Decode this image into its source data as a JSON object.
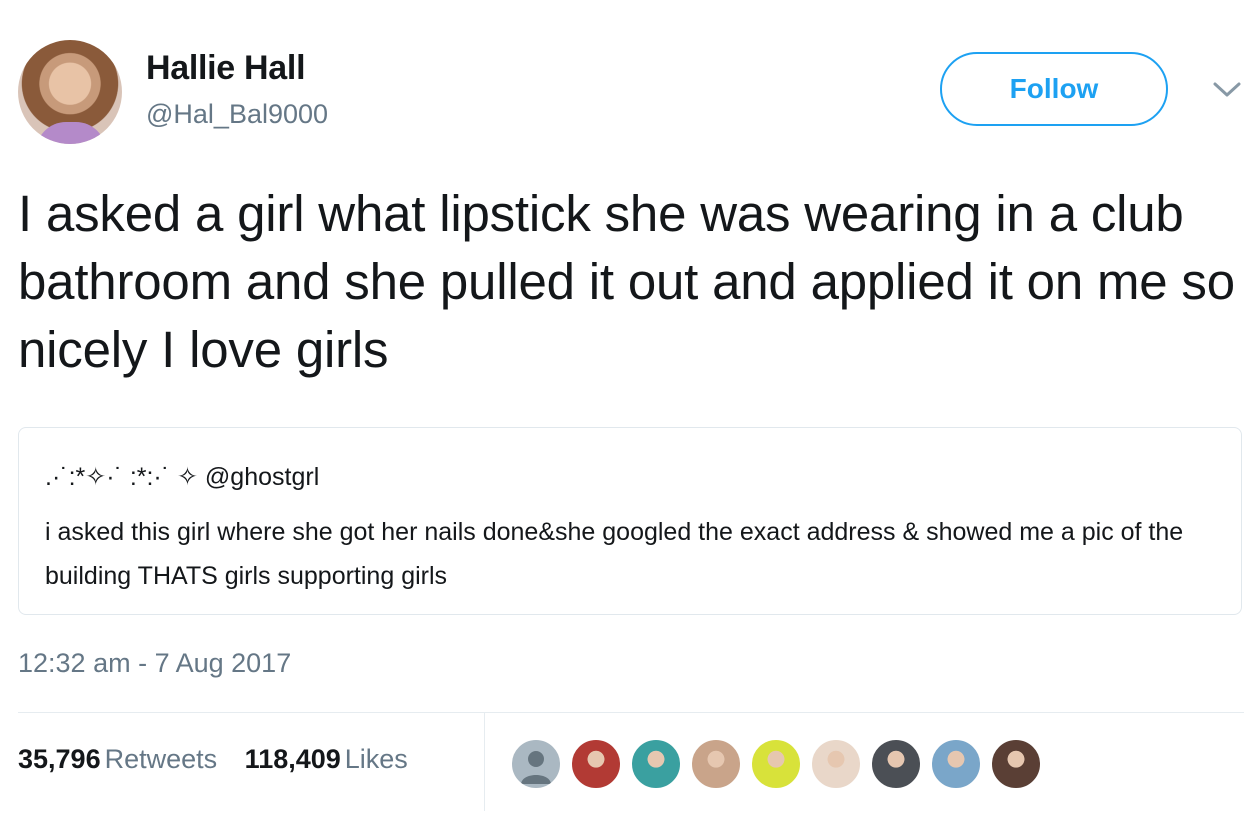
{
  "user": {
    "display_name": "Hallie Hall",
    "handle": "@Hal_Bal9000"
  },
  "actions": {
    "follow_label": "Follow",
    "more_icon": "chevron-down-icon"
  },
  "tweet": {
    "text": "I asked a girl what lipstick she was wearing in a club bathroom and she pulled it out and applied it on me so nicely I love girls",
    "timestamp": "12:32 am - 7 Aug 2017"
  },
  "quoted_tweet": {
    "name": ".·˙:*✧·˙ :*:·˙ ✧ @ghostgrl",
    "text": "i asked this girl where she got her nails done&she googled the exact address & showed me a pic of the building THATS girls supporting girls"
  },
  "stats": {
    "retweets_count": "35,796",
    "retweets_label": "Retweets",
    "likes_count": "118,409",
    "likes_label": "Likes"
  },
  "colors": {
    "accent": "#1da1f2",
    "muted": "#657786",
    "text": "#14171a",
    "border": "#e1e8ed"
  },
  "likers": [
    {
      "color": "#aab8c2",
      "type": "default"
    },
    {
      "color": "#b23a34",
      "type": "photo"
    },
    {
      "color": "#3aa0a0",
      "type": "photo"
    },
    {
      "color": "#c9a48a",
      "type": "photo"
    },
    {
      "color": "#d8e23a",
      "type": "photo"
    },
    {
      "color": "#e9d7c9",
      "type": "photo"
    },
    {
      "color": "#4b4f55",
      "type": "photo"
    },
    {
      "color": "#7aa6c9",
      "type": "photo"
    },
    {
      "color": "#5a3f35",
      "type": "photo"
    }
  ]
}
